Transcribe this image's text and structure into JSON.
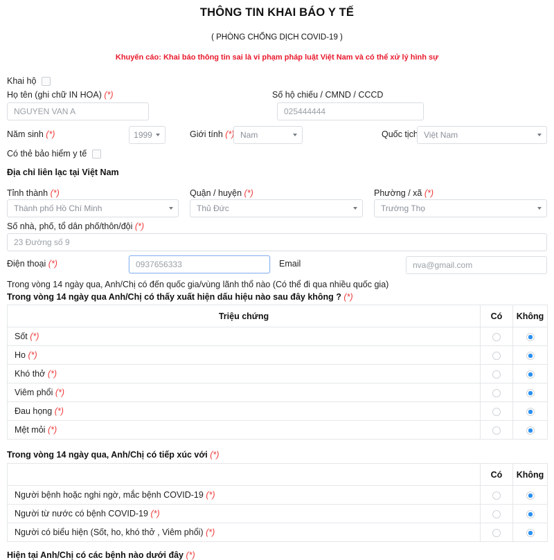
{
  "header": {
    "title": "THÔNG TIN KHAI BÁO Y TẾ",
    "subtitle": "( PHÒNG CHỐNG DỊCH COVID-19 )",
    "warning": "Khuyến cáo: Khai báo thông tin sai là vi phạm pháp luật Việt Nam và có thể xử lý hình sự"
  },
  "colors": {
    "warning_red": "#e8192c",
    "required_red": "#ef3a3a",
    "radio_blue": "#2a90f0",
    "focus_border": "#8cb4f0",
    "field_border": "#d9dde2"
  },
  "form": {
    "proxy_declare_label": "Khai hộ",
    "fullname_label": "Họ tên (ghi chữ IN HOA)",
    "fullname_value": "NGUYEN VAN A",
    "passport_label": "Số hộ chiếu / CMND / CCCD",
    "passport_value": "025444444",
    "birthyear_label": "Năm sinh",
    "birthyear_value": "1999",
    "gender_label": "Giới tính",
    "gender_value": "Nam",
    "nationality_label": "Quốc tịch",
    "nationality_value": "Việt Nam",
    "insurance_label": "Có thẻ bảo hiểm y tế",
    "address_section_title": "Địa chỉ liên lạc tại Việt Nam",
    "province_label": "Tỉnh thành",
    "province_value": "Thành phố Hồ Chí Minh",
    "district_label": "Quận / huyện",
    "district_value": "Thủ Đức",
    "ward_label": "Phường / xã",
    "ward_value": "Trường Thọ",
    "street_label": "Số nhà, phố, tổ dân phố/thôn/đội",
    "street_value": "23 Đường số 9",
    "phone_label": "Điện thoại",
    "phone_value": "0937656333",
    "email_label": "Email",
    "email_value": "nva@gmail.com",
    "travel_question": "Trong vòng 14 ngày qua, Anh/Chị có đến quốc gia/vùng lãnh thổ nào (Có thể đi qua nhiều quốc gia)",
    "required_mark": "(*)"
  },
  "symptoms": {
    "question": "Trong vòng 14 ngày qua Anh/Chị có thấy xuất hiện dấu hiệu nào sau đây không ?",
    "col_item": "Triệu chứng",
    "col_yes": "Có",
    "col_no": "Không",
    "rows": [
      {
        "label": "Sốt",
        "answer": "no"
      },
      {
        "label": "Ho",
        "answer": "no"
      },
      {
        "label": "Khó thở",
        "answer": "no"
      },
      {
        "label": "Viêm phổi",
        "answer": "no"
      },
      {
        "label": "Đau họng",
        "answer": "no"
      },
      {
        "label": "Mệt mỏi",
        "answer": "no"
      }
    ]
  },
  "contacts": {
    "question": "Trong vòng 14 ngày qua, Anh/Chị có tiếp xúc với",
    "col_item": "",
    "col_yes": "Có",
    "col_no": "Không",
    "rows": [
      {
        "label": "Người bệnh hoặc nghi ngờ, mắc bệnh COVID-19",
        "answer": "no"
      },
      {
        "label": "Người từ nước có bệnh COVID-19",
        "answer": "no"
      },
      {
        "label": "Người có biểu hiện (Sốt, ho, khó thở , Viêm phổi)",
        "answer": "no"
      }
    ]
  },
  "diseases": {
    "question": "Hiện tại Anh/Chị có các bệnh nào dưới đây"
  }
}
